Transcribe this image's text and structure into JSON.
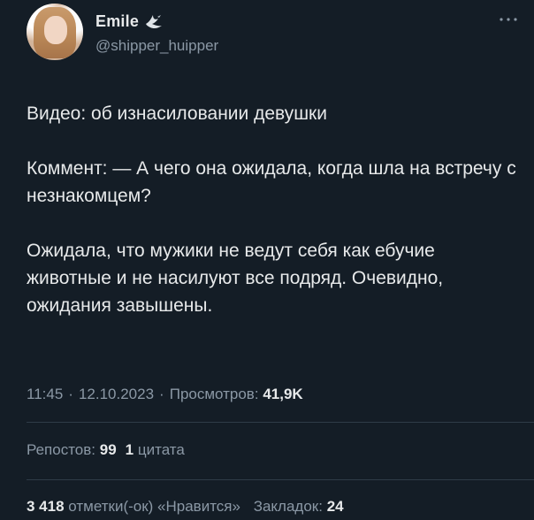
{
  "author": {
    "display_name": "Emile",
    "handle": "@shipper_huipper",
    "avatar_icon": "avatar-photo",
    "badge_icon": "dove-icon"
  },
  "menu_icon": "more-dots-icon",
  "tweet": {
    "paragraph1": "Видео: об изнасиловании девушки",
    "paragraph2": "Коммент: — А чего она ожидала, когда шла на встречу с незнакомцем?",
    "paragraph3": "Ожидала, что мужики не ведут себя как ебучие животные и не насилуют все подряд. Очевидно, ожидания завышены."
  },
  "meta": {
    "time": "11:45",
    "date": "12.10.2023",
    "separator": "·",
    "views_label": "Просмотров:",
    "views_count": "41,9K"
  },
  "stats": {
    "reposts_label": "Репостов:",
    "reposts_count": "99",
    "quotes_count": "1",
    "quotes_label": "цитата",
    "likes_count": "3 418",
    "likes_label": "отметки(-ок) «Нравится»",
    "bookmarks_label": "Закладок:",
    "bookmarks_count": "24"
  },
  "colors": {
    "background": "#141d26",
    "text_primary": "#e7e9ea",
    "text_secondary": "#8b98a5",
    "divider": "#2f3b47"
  }
}
